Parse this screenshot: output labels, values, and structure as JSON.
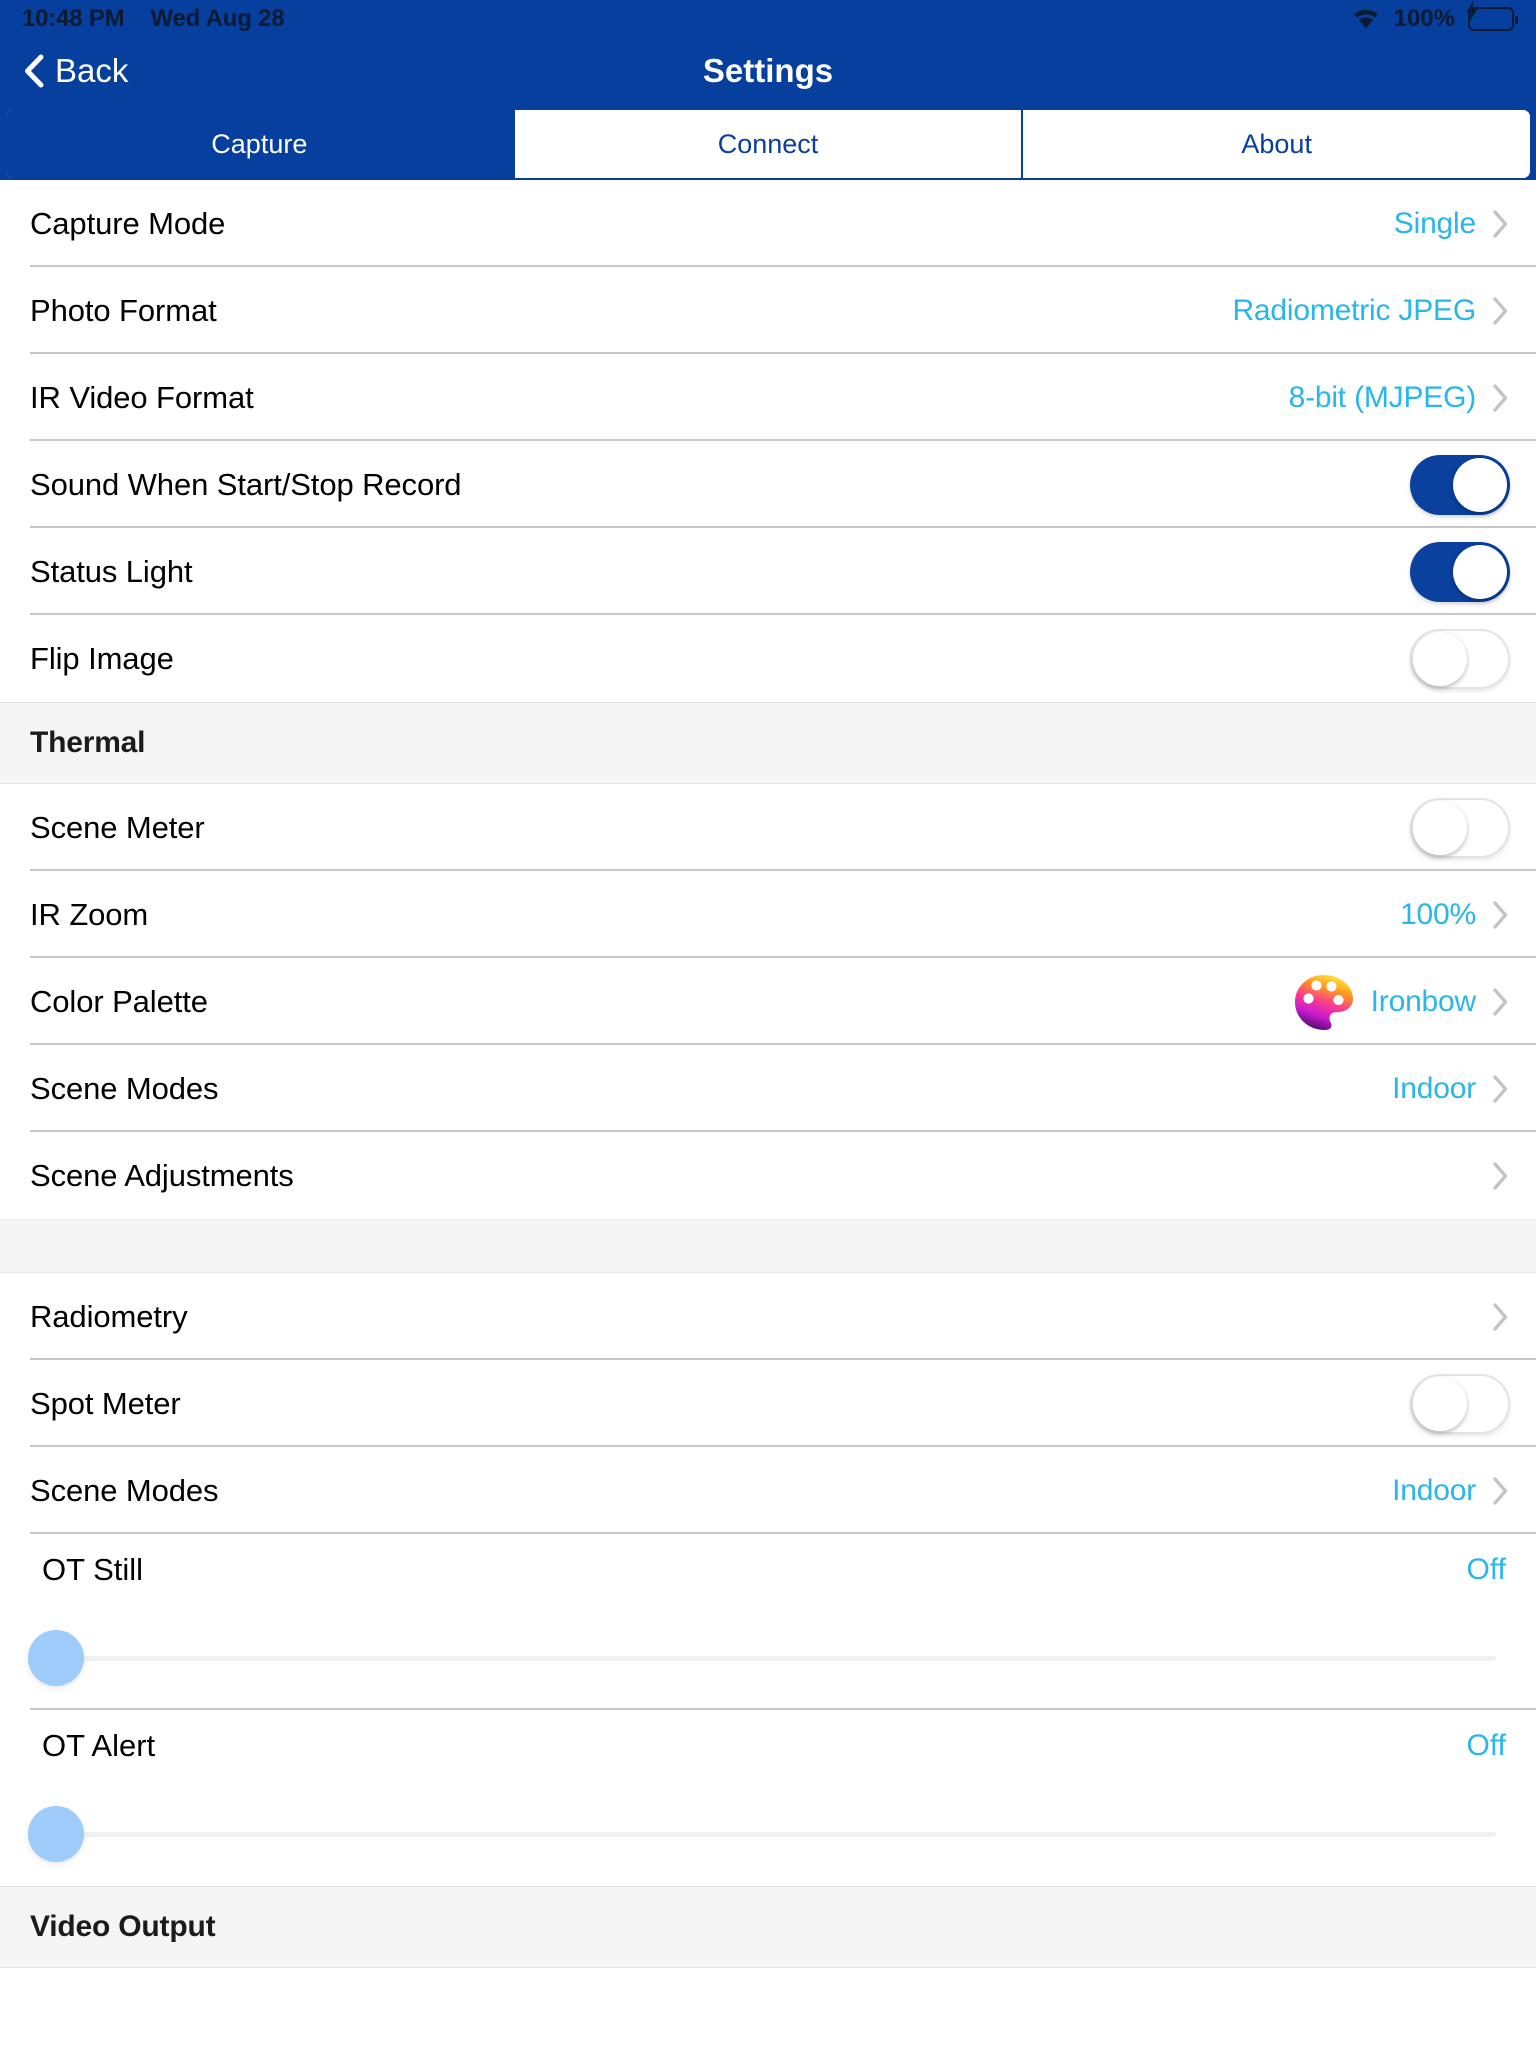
{
  "status_bar": {
    "time": "10:48 PM",
    "date": "Wed Aug 28",
    "wifi_icon": "wifi-icon",
    "battery_percent": "100%",
    "battery_icon": "battery-charging-icon",
    "battery_fill_color": "#4cd964"
  },
  "nav": {
    "back_label": "Back",
    "back_icon": "chevron-left-icon",
    "title": "Settings",
    "bar_color": "#063f9e"
  },
  "segmented_control": {
    "selected": "Capture",
    "items": [
      {
        "label": "Capture",
        "active": true
      },
      {
        "label": "Connect",
        "active": false
      },
      {
        "label": "About",
        "active": false
      }
    ]
  },
  "theme": {
    "accent_blue": "#063f9e",
    "value_cyan": "#29b6e8",
    "section_bg": "#f5f5f6",
    "separator": "#c8c7cc",
    "slider_thumb": "#9ecbfa"
  },
  "sections": [
    {
      "header": null,
      "rows": [
        {
          "label": "Capture Mode",
          "type": "disclosure",
          "value": "Single"
        },
        {
          "label": "Photo Format",
          "type": "disclosure",
          "value": "Radiometric JPEG"
        },
        {
          "label": "IR Video Format",
          "type": "disclosure",
          "value": "8-bit (MJPEG)"
        },
        {
          "label": "Sound When Start/Stop Record",
          "type": "toggle",
          "value": "on"
        },
        {
          "label": "Status Light",
          "type": "toggle",
          "value": "on"
        },
        {
          "label": "Flip Image",
          "type": "toggle",
          "value": "off"
        }
      ]
    },
    {
      "header": "Thermal",
      "rows": [
        {
          "label": "Scene Meter",
          "type": "toggle",
          "value": "off"
        },
        {
          "label": "IR Zoom",
          "type": "disclosure",
          "value": "100%"
        },
        {
          "label": "Color Palette",
          "type": "disclosure",
          "value": "Ironbow",
          "icon": "color-palette-icon"
        },
        {
          "label": "Scene Modes",
          "type": "disclosure",
          "value": "Indoor"
        },
        {
          "label": "Scene Adjustments",
          "type": "disclosure",
          "value": ""
        }
      ]
    },
    {
      "header": null,
      "gap_before": true,
      "rows": [
        {
          "label": "Radiometry",
          "type": "disclosure",
          "value": ""
        },
        {
          "label": "Spot Meter",
          "type": "toggle",
          "value": "off"
        },
        {
          "label": "Scene Modes",
          "type": "disclosure",
          "value": "Indoor"
        },
        {
          "label": "OT Still",
          "type": "slider",
          "value": "Off",
          "slider_position": 0
        },
        {
          "label": "OT Alert",
          "type": "slider",
          "value": "Off",
          "slider_position": 0
        }
      ]
    },
    {
      "header": "Video Output",
      "rows": []
    }
  ]
}
